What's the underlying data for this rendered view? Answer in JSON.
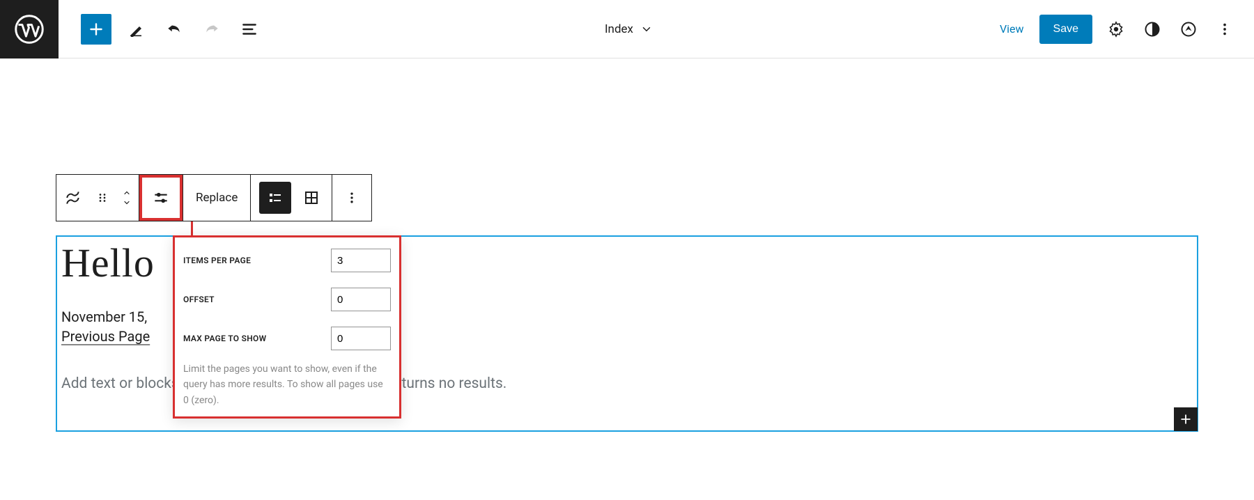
{
  "topbar": {
    "template_label": "Index",
    "view_label": "View",
    "save_label": "Save"
  },
  "block_toolbar": {
    "replace_label": "Replace"
  },
  "display_settings": {
    "items_per_page_label": "Items per page",
    "items_per_page_value": "3",
    "offset_label": "Offset",
    "offset_value": "0",
    "max_page_label": "Max page to show",
    "max_page_value": "0",
    "help_text": "Limit the pages you want to show, even if the query has more results. To show all pages use 0 (zero)."
  },
  "content": {
    "post_title": "Hello",
    "post_date": "November 15,",
    "prev_page_label": "Previous Page",
    "no_results_placeholder": "Add text or blocks that will display when the query returns no results."
  }
}
